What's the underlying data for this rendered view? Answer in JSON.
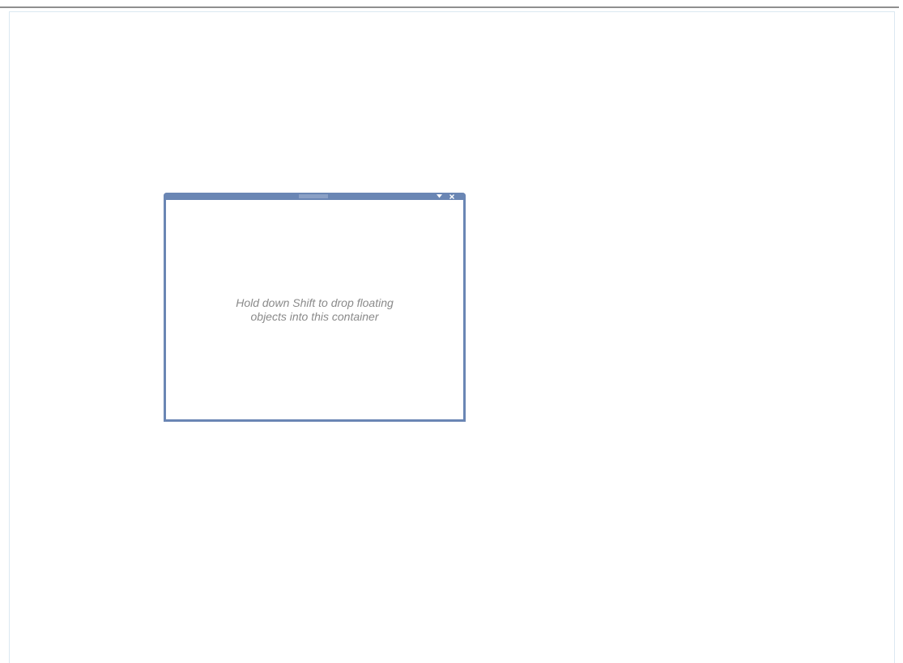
{
  "container": {
    "hint_line1": "Hold down Shift to drop floating",
    "hint_line2": "objects into this container",
    "menu_icon": "triangle-down-icon",
    "close_icon": "close-icon",
    "accent_color": "#6a86b4"
  }
}
